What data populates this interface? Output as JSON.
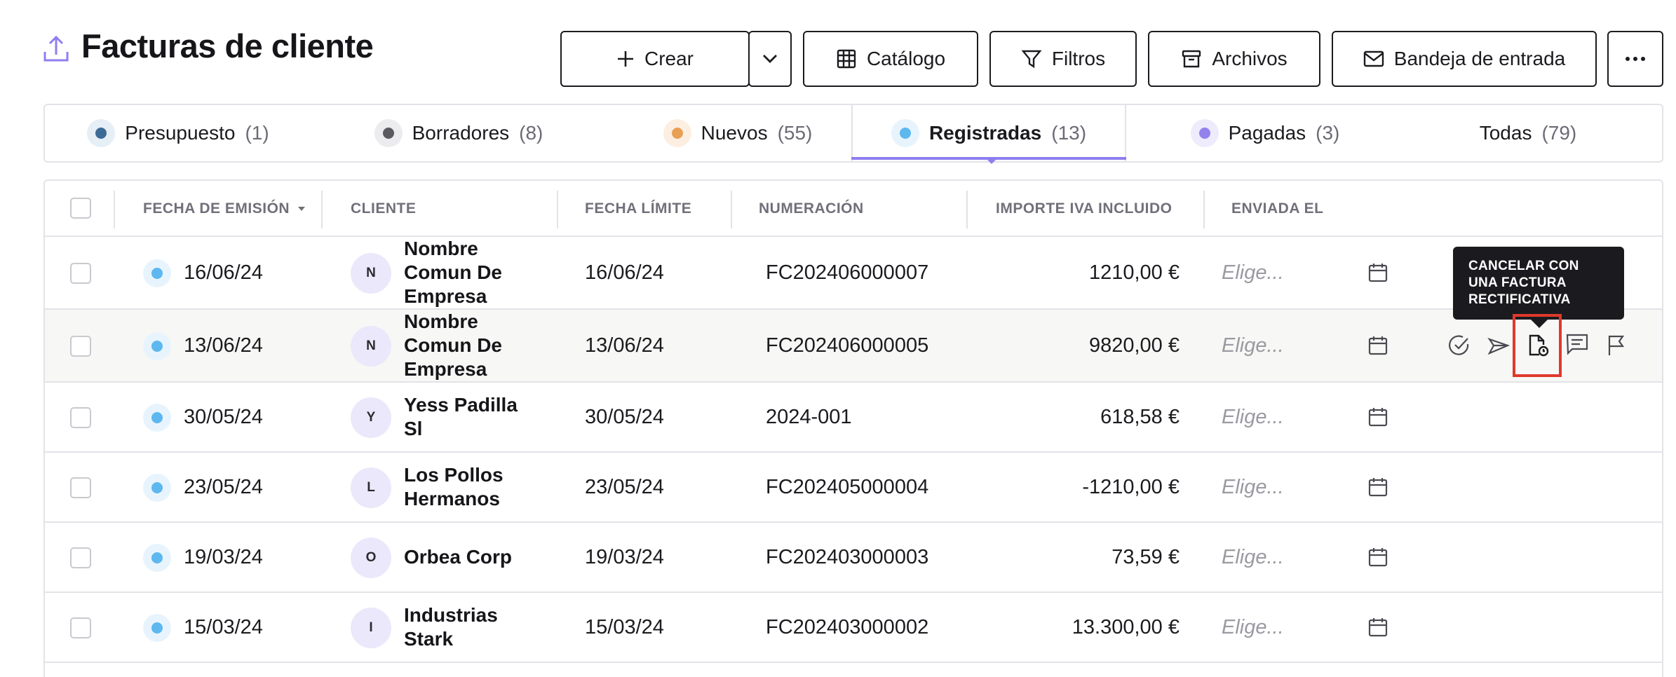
{
  "header": {
    "title": "Facturas de cliente",
    "icon": "upload-tray-icon",
    "buttons": {
      "create": "Crear",
      "catalog": "Catálogo",
      "filters": "Filtros",
      "files": "Archivos",
      "inbox": "Bandeja de entrada"
    }
  },
  "tabs": [
    {
      "label": "Presupuesto",
      "count": "(1)",
      "dot_color": "#3d6b96",
      "bg": "#e6eef6"
    },
    {
      "label": "Borradores",
      "count": "(8)",
      "dot_color": "#5a5a60",
      "bg": "#ececee"
    },
    {
      "label": "Nuevos",
      "count": "(55)",
      "dot_color": "#e8a055",
      "bg": "#fcefe2"
    },
    {
      "label": "Registradas",
      "count": "(13)",
      "dot_color": "#5cb8ef",
      "bg": "#e8f4fd",
      "active": true
    },
    {
      "label": "Pagadas",
      "count": "(3)",
      "dot_color": "#9381ee",
      "bg": "#eeebfc"
    },
    {
      "label": "Todas",
      "count": "(79)"
    }
  ],
  "table": {
    "columns": {
      "issue_date": "FECHA DE EMISIÓN",
      "client": "CLIENTE",
      "due_date": "FECHA LÍMITE",
      "numbering": "NUMERACIÓN",
      "amount": "IMPORTE IVA INCLUIDO",
      "sent": "ENVIADA EL"
    },
    "rows": [
      {
        "issue_date": "16/06/24",
        "initial": "N",
        "client": "Nombre Comun De Empresa",
        "due_date": "16/06/24",
        "number": "FC202406000007",
        "amount": "1210,00 €",
        "sent": "Elige..."
      },
      {
        "issue_date": "13/06/24",
        "initial": "N",
        "client": "Nombre Comun De Empresa",
        "due_date": "13/06/24",
        "number": "FC202406000005",
        "amount": "9820,00 €",
        "sent": "Elige..."
      },
      {
        "issue_date": "30/05/24",
        "initial": "Y",
        "client": "Yess Padilla Sl",
        "due_date": "30/05/24",
        "number": "2024-001",
        "amount": "618,58 €",
        "sent": "Elige..."
      },
      {
        "issue_date": "23/05/24",
        "initial": "L",
        "client": "Los Pollos Hermanos",
        "due_date": "23/05/24",
        "number": "FC202405000004",
        "amount": "-1210,00 €",
        "sent": "Elige..."
      },
      {
        "issue_date": "19/03/24",
        "initial": "O",
        "client": "Orbea Corp",
        "due_date": "19/03/24",
        "number": "FC202403000003",
        "amount": "73,59 €",
        "sent": "Elige..."
      },
      {
        "issue_date": "15/03/24",
        "initial": "I",
        "client": "Industrias Stark",
        "due_date": "15/03/24",
        "number": "FC202403000002",
        "amount": "13.300,00 €",
        "sent": "Elige..."
      }
    ]
  },
  "tooltip": {
    "text": "CANCELAR CON UNA FACTURA RECTIFICATIVA"
  },
  "row_actions": [
    "check-circle-icon",
    "send-icon",
    "rectify-document-icon",
    "comment-icon",
    "flag-icon"
  ]
}
